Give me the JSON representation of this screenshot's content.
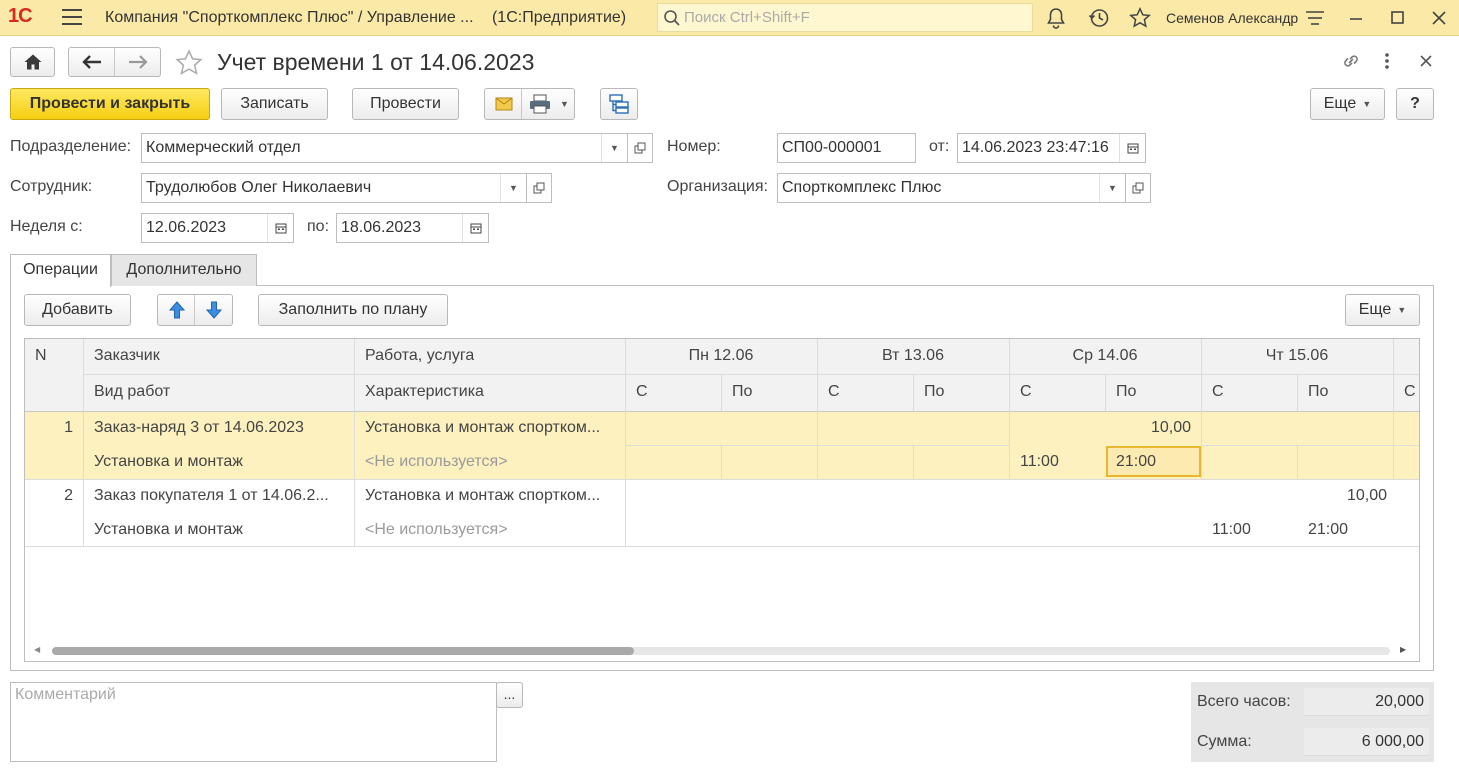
{
  "titlebar": {
    "logo": "1С",
    "title": "Компания \"Спорткомплекс Плюс\" / Управление ...",
    "platform": "(1С:Предприятие)",
    "search_placeholder": "Поиск Ctrl+Shift+F",
    "user": "Семенов Александр"
  },
  "document": {
    "title": "Учет времени 1 от 14.06.2023"
  },
  "toolbar": {
    "post_close": "Провести и закрыть",
    "save": "Записать",
    "post": "Провести",
    "more": "Еще",
    "help": "?"
  },
  "form": {
    "department_label": "Подразделение:",
    "department_value": "Коммерческий отдел",
    "number_label": "Номер:",
    "number_value": "СП00-000001",
    "date_label": "от:",
    "date_value": "14.06.2023 23:47:16",
    "employee_label": "Сотрудник:",
    "employee_value": "Трудолюбов Олег Николаевич",
    "org_label": "Организация:",
    "org_value": "Спорткомплекс Плюс",
    "week_label": "Неделя с:",
    "week_from": "12.06.2023",
    "week_to_label": "по:",
    "week_to": "18.06.2023"
  },
  "tabs": [
    {
      "label": "Операции",
      "active": true
    },
    {
      "label": "Дополнительно",
      "active": false
    }
  ],
  "grid_toolbar": {
    "add": "Добавить",
    "fill_by_plan": "Заполнить по плану",
    "more": "Еще"
  },
  "grid": {
    "headers": {
      "n": "N",
      "customer": "Заказчик",
      "work": "Работа, услуга",
      "work_type": "Вид работ",
      "characteristic": "Характеристика",
      "days": [
        "Пн 12.06",
        "Вт 13.06",
        "Ср 14.06",
        "Чт 15.06"
      ],
      "from": "С",
      "to": "По"
    },
    "rows": [
      {
        "n": "1",
        "customer": "Заказ-наряд 3 от 14.06.2023",
        "work": "Установка и монтаж спортком...",
        "work_type": "Установка и монтаж",
        "characteristic": "<Не используется>",
        "hours": "10,00",
        "from": "11:00",
        "to": "21:00"
      },
      {
        "n": "2",
        "customer": "Заказ покупателя 1 от 14.06.2...",
        "work": "Установка и монтаж спортком...",
        "work_type": "Установка и монтаж",
        "characteristic": "<Не используется>",
        "hours": "10,00",
        "from": "11:00",
        "to": "21:00"
      }
    ]
  },
  "bottom": {
    "comment_placeholder": "Комментарий",
    "ellipsis": "...",
    "total_hours_label": "Всего часов:",
    "total_hours_value": "20,000",
    "sum_label": "Сумма:",
    "sum_value": "6 000,00"
  },
  "colors": {
    "titlebar": "#fbeaa7",
    "primary_button": "#f5cf12",
    "row_highlight": "#fdf1bf",
    "logo": "#d9281c"
  }
}
